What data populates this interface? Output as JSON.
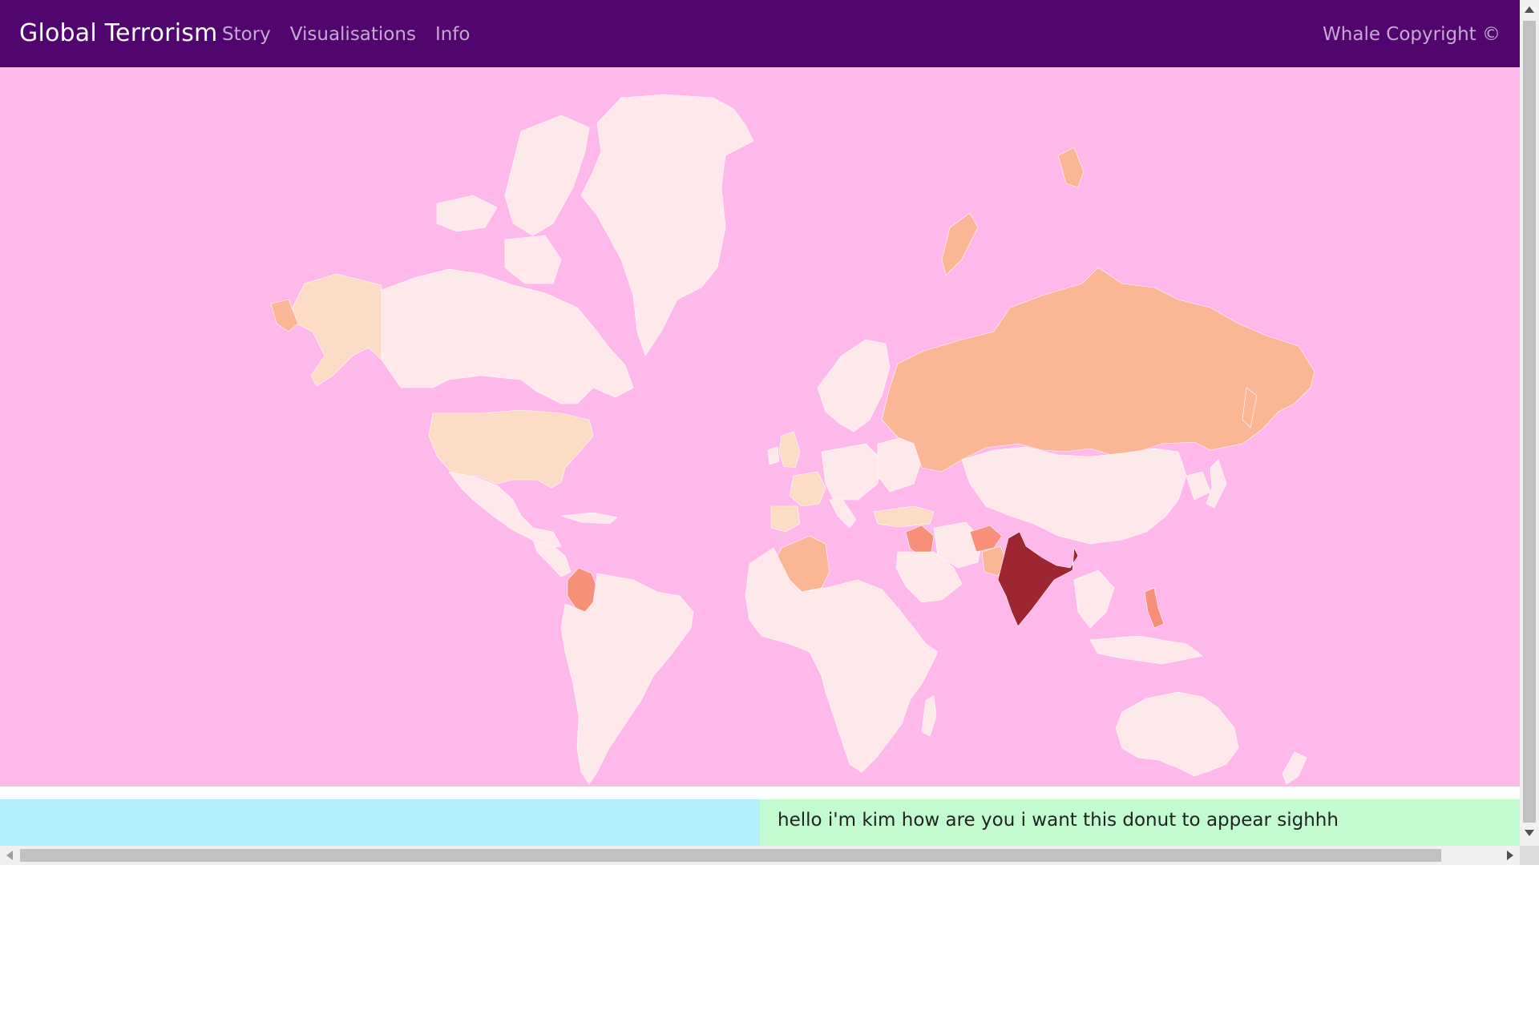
{
  "navbar": {
    "brand": "Global Terrorism",
    "links": [
      "Story",
      "Visualisations",
      "Info"
    ],
    "right_text": "Whale Copyright ©",
    "background": "#50056f"
  },
  "map": {
    "background": "#ffb8ea",
    "color_scale": {
      "lowest": "#fde9e9",
      "low": "#fcdcc4",
      "medium": "#fbb696",
      "high": "#f89079",
      "highest": "#9e2532"
    },
    "countries": [
      {
        "name": "India",
        "level": "highest"
      },
      {
        "name": "Iraq",
        "level": "high"
      },
      {
        "name": "Afghanistan",
        "level": "high"
      },
      {
        "name": "Pakistan",
        "level": "medium"
      },
      {
        "name": "Colombia",
        "level": "high"
      },
      {
        "name": "Philippines",
        "level": "high"
      },
      {
        "name": "Russia",
        "level": "medium"
      },
      {
        "name": "Algeria",
        "level": "medium"
      },
      {
        "name": "United States",
        "level": "low"
      },
      {
        "name": "Alaska",
        "level": "low"
      },
      {
        "name": "United Kingdom",
        "level": "low"
      },
      {
        "name": "France",
        "level": "low"
      },
      {
        "name": "Spain",
        "level": "low"
      },
      {
        "name": "Turkey",
        "level": "low"
      },
      {
        "name": "Canada",
        "level": "lowest"
      },
      {
        "name": "Greenland",
        "level": "lowest"
      },
      {
        "name": "China",
        "level": "lowest"
      },
      {
        "name": "Brazil",
        "level": "lowest"
      },
      {
        "name": "Australia",
        "level": "lowest"
      }
    ]
  },
  "bottom_band": {
    "left_color": "#b3effa",
    "right_color": "#c1fbcf",
    "text": "hello i'm kim how are you i want this donut to appear sighhh"
  }
}
